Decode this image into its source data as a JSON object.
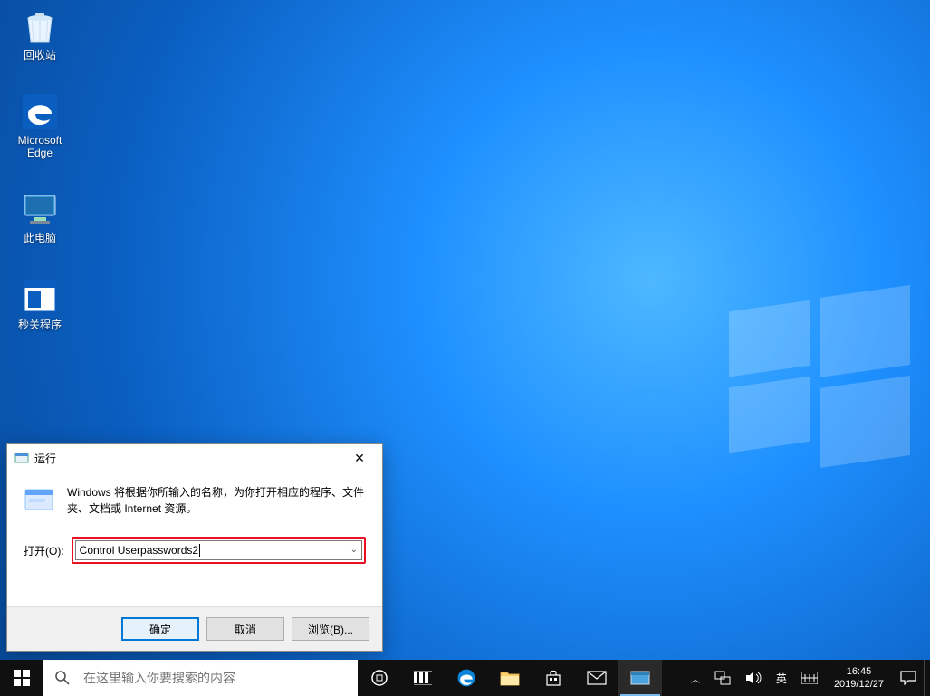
{
  "desktop_icons": [
    {
      "id": "recycle-bin",
      "label": "回收站"
    },
    {
      "id": "edge",
      "label": "Microsoft\nEdge"
    },
    {
      "id": "this-pc",
      "label": "此电脑"
    },
    {
      "id": "sec-close",
      "label": "秒关程序"
    }
  ],
  "run_dialog": {
    "title": "运行",
    "description": "Windows 将根据你所输入的名称，为你打开相应的程序、文件夹、文档或 Internet 资源。",
    "open_label": "打开(O):",
    "open_value": "Control Userpasswords2",
    "buttons": {
      "ok": "确定",
      "cancel": "取消",
      "browse": "浏览(B)..."
    }
  },
  "taskbar": {
    "search_placeholder": "在这里输入你要搜索的内容",
    "ime": "英",
    "clock_time": "16:45",
    "clock_date": "2019/12/27"
  }
}
